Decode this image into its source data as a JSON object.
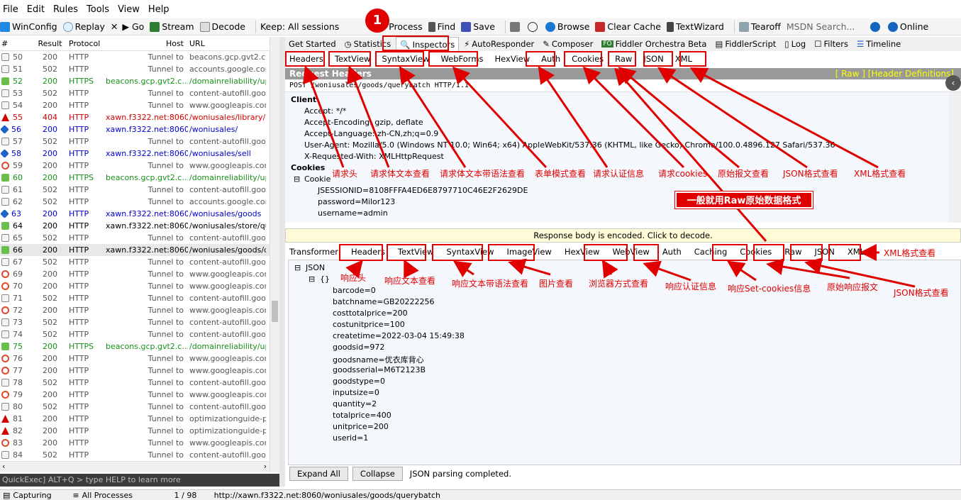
{
  "menu": [
    "File",
    "Edit",
    "Rules",
    "Tools",
    "View",
    "Help"
  ],
  "toolbar": [
    {
      "label": "WinConfig",
      "icon": "windows-icon"
    },
    {
      "label": "Replay",
      "icon": "replay-icon"
    },
    {
      "label": "▶ Go",
      "icon": "remove-icon"
    },
    {
      "label": "Stream",
      "icon": "stream-icon"
    },
    {
      "label": "Decode",
      "icon": "decode-icon"
    },
    {
      "label": "Keep: All sessions",
      "icon": ""
    },
    {
      "label": "Any Process",
      "icon": "crosshair-icon"
    },
    {
      "label": "Find",
      "icon": "find-icon"
    },
    {
      "label": "Save",
      "icon": "save-icon"
    },
    {
      "label": "Browse",
      "icon": "browser-icon"
    },
    {
      "label": "Clear Cache",
      "icon": "clear-cache-icon"
    },
    {
      "label": "TextWizard",
      "icon": "textwizard-icon"
    },
    {
      "label": "Tearoff",
      "icon": "tearoff-icon"
    },
    {
      "label": "MSDN Search...",
      "icon": ""
    },
    {
      "label": "Online",
      "icon": "online-icon"
    }
  ],
  "sessions": {
    "columns": [
      "#",
      "Result",
      "Protocol",
      "Host",
      "URL"
    ],
    "rows": [
      {
        "id": "50",
        "result": "200",
        "protocol": "HTTP",
        "host": "Tunnel to",
        "url": "beacons.gcp.gvt2.cor",
        "color": "#555",
        "icon": "lock"
      },
      {
        "id": "51",
        "result": "502",
        "protocol": "HTTP",
        "host": "Tunnel to",
        "url": "accounts.google.com:",
        "color": "#555",
        "icon": "lock"
      },
      {
        "id": "52",
        "result": "200",
        "protocol": "HTTPS",
        "host": "beacons.gcp.gvt2.c...",
        "url": "/domainreliability/uplo",
        "color": "#1a8f1a",
        "icon": "arrow"
      },
      {
        "id": "53",
        "result": "502",
        "protocol": "HTTP",
        "host": "Tunnel to",
        "url": "content-autofill.googl",
        "color": "#555",
        "icon": "lock"
      },
      {
        "id": "54",
        "result": "200",
        "protocol": "HTTP",
        "host": "Tunnel to",
        "url": "www.googleapis.com:",
        "color": "#555",
        "icon": "lock"
      },
      {
        "id": "55",
        "result": "404",
        "protocol": "HTTP",
        "host": "xawn.f3322.net:8060",
        "url": "/woniusales/library/cs",
        "color": "#d00000",
        "icon": "warn"
      },
      {
        "id": "56",
        "result": "200",
        "protocol": "HTTP",
        "host": "xawn.f3322.net:8060",
        "url": "/woniusales/",
        "color": "#0000cc",
        "icon": "diamond"
      },
      {
        "id": "57",
        "result": "502",
        "protocol": "HTTP",
        "host": "Tunnel to",
        "url": "content-autofill.googl",
        "color": "#555",
        "icon": "lock"
      },
      {
        "id": "58",
        "result": "200",
        "protocol": "HTTP",
        "host": "xawn.f3322.net:8060",
        "url": "/woniusales/sell",
        "color": "#0000cc",
        "icon": "diamond"
      },
      {
        "id": "59",
        "result": "200",
        "protocol": "HTTP",
        "host": "Tunnel to",
        "url": "www.googleapis.com:",
        "color": "#555",
        "icon": "block"
      },
      {
        "id": "60",
        "result": "200",
        "protocol": "HTTPS",
        "host": "beacons.gcp.gvt2.c...",
        "url": "/domainreliability/uplo",
        "color": "#1a8f1a",
        "icon": "arrow"
      },
      {
        "id": "61",
        "result": "502",
        "protocol": "HTTP",
        "host": "Tunnel to",
        "url": "content-autofill.googl",
        "color": "#555",
        "icon": "lock"
      },
      {
        "id": "62",
        "result": "502",
        "protocol": "HTTP",
        "host": "Tunnel to",
        "url": "accounts.google.com:",
        "color": "#555",
        "icon": "lock"
      },
      {
        "id": "63",
        "result": "200",
        "protocol": "HTTP",
        "host": "xawn.f3322.net:8060",
        "url": "/woniusales/goods",
        "color": "#0000cc",
        "icon": "diamond"
      },
      {
        "id": "64",
        "result": "200",
        "protocol": "HTTP",
        "host": "xawn.f3322.net:8060",
        "url": "/woniusales/store/que",
        "color": "#000",
        "icon": "arrow"
      },
      {
        "id": "65",
        "result": "502",
        "protocol": "HTTP",
        "host": "Tunnel to",
        "url": "content-autofill.googl",
        "color": "#555",
        "icon": "lock"
      },
      {
        "id": "66",
        "result": "200",
        "protocol": "HTTP",
        "host": "xawn.f3322.net:8060",
        "url": "/woniusales/goods/qu",
        "color": "#000",
        "icon": "arrow",
        "selected": true
      },
      {
        "id": "67",
        "result": "502",
        "protocol": "HTTP",
        "host": "Tunnel to",
        "url": "content-autofill.googl",
        "color": "#555",
        "icon": "lock"
      },
      {
        "id": "69",
        "result": "200",
        "protocol": "HTTP",
        "host": "Tunnel to",
        "url": "www.googleapis.com:",
        "color": "#555",
        "icon": "block"
      },
      {
        "id": "70",
        "result": "200",
        "protocol": "HTTP",
        "host": "Tunnel to",
        "url": "www.googleapis.com:",
        "color": "#555",
        "icon": "block"
      },
      {
        "id": "71",
        "result": "502",
        "protocol": "HTTP",
        "host": "Tunnel to",
        "url": "content-autofill.googl",
        "color": "#555",
        "icon": "lock"
      },
      {
        "id": "72",
        "result": "200",
        "protocol": "HTTP",
        "host": "Tunnel to",
        "url": "www.googleapis.com:",
        "color": "#555",
        "icon": "block"
      },
      {
        "id": "73",
        "result": "502",
        "protocol": "HTTP",
        "host": "Tunnel to",
        "url": "content-autofill.googl",
        "color": "#555",
        "icon": "lock"
      },
      {
        "id": "74",
        "result": "502",
        "protocol": "HTTP",
        "host": "Tunnel to",
        "url": "content-autofill.googl",
        "color": "#555",
        "icon": "lock"
      },
      {
        "id": "75",
        "result": "200",
        "protocol": "HTTPS",
        "host": "beacons.gcp.gvt2.c...",
        "url": "/domainreliability/uplo",
        "color": "#1a8f1a",
        "icon": "arrow"
      },
      {
        "id": "76",
        "result": "200",
        "protocol": "HTTP",
        "host": "Tunnel to",
        "url": "www.googleapis.com:",
        "color": "#555",
        "icon": "block"
      },
      {
        "id": "77",
        "result": "200",
        "protocol": "HTTP",
        "host": "Tunnel to",
        "url": "www.googleapis.com:",
        "color": "#555",
        "icon": "block"
      },
      {
        "id": "78",
        "result": "502",
        "protocol": "HTTP",
        "host": "Tunnel to",
        "url": "content-autofill.googl",
        "color": "#555",
        "icon": "lock"
      },
      {
        "id": "79",
        "result": "200",
        "protocol": "HTTP",
        "host": "Tunnel to",
        "url": "www.googleapis.com:",
        "color": "#555",
        "icon": "block"
      },
      {
        "id": "80",
        "result": "502",
        "protocol": "HTTP",
        "host": "Tunnel to",
        "url": "content-autofill.googl",
        "color": "#555",
        "icon": "lock"
      },
      {
        "id": "81",
        "result": "200",
        "protocol": "HTTP",
        "host": "Tunnel to",
        "url": "optimizationguide-pa.",
        "color": "#555",
        "icon": "warn"
      },
      {
        "id": "82",
        "result": "200",
        "protocol": "HTTP",
        "host": "Tunnel to",
        "url": "optimizationguide-pa.",
        "color": "#555",
        "icon": "warn"
      },
      {
        "id": "83",
        "result": "200",
        "protocol": "HTTP",
        "host": "Tunnel to",
        "url": "www.googleapis.com:",
        "color": "#555",
        "icon": "block"
      },
      {
        "id": "84",
        "result": "502",
        "protocol": "HTTP",
        "host": "Tunnel to",
        "url": "content-autofill.googl",
        "color": "#555",
        "icon": "lock"
      }
    ]
  },
  "quickexec": "QuickExec] ALT+Q > type HELP to learn more",
  "statusbar": {
    "capturing": "Capturing",
    "processes": "All Processes",
    "count": "1 / 98",
    "url": "http://xawn.f3322.net:8060/woniusales/goods/querybatch"
  },
  "inspector_tabs": [
    "Get Started",
    "Statistics",
    "Inspectors",
    "AutoResponder",
    "Composer",
    "Fiddler Orchestra Beta",
    "FiddlerScript",
    "Log",
    "Filters",
    "Timeline"
  ],
  "request_tabs": [
    "Headers",
    "TextView",
    "SyntaxView",
    "WebForms",
    "HexView",
    "Auth",
    "Cookies",
    "Raw",
    "JSON",
    "XML"
  ],
  "request_headers": {
    "title": "Request Headers",
    "links": "[ Raw ]   [Header Definitions]",
    "request_line": "POST /woniusales/goods/querybatch HTTP/1.1",
    "client_label": "Client",
    "client": [
      "Accept: */*",
      "Accept-Encoding: gzip, deflate",
      "Accept-Language: zh-CN,zh;q=0.9",
      "User-Agent: Mozilla/5.0 (Windows NT 10.0; Win64; x64) AppleWebKit/537.36 (KHTML, like Gecko) Chrome/100.0.4896.127 Safari/537.36",
      "X-Requested-With: XMLHttpRequest"
    ],
    "cookies_label": "Cookies",
    "cookie_label": "Cookie",
    "cookies": [
      "JSESSIONID=8108FFFA4ED6E8797710C46E2F2629DE",
      "password=Milor123",
      "username=admin"
    ]
  },
  "encoded_notice": "Response body is encoded. Click to decode.",
  "response_tabs": [
    "Transformer",
    "Headers",
    "TextView",
    "SyntaxView",
    "ImageView",
    "HexView",
    "WebView",
    "Auth",
    "Caching",
    "Cookies",
    "Raw",
    "JSON",
    "XML"
  ],
  "json_tree": {
    "root": "JSON",
    "obj": "{}",
    "items": [
      "barcode=0",
      "batchname=GB20222256",
      "costtotalprice=200",
      "costunitprice=100",
      "createtime=2022-03-04 15:49:38",
      "goodsid=972",
      "goodsname=优衣库背心",
      "goodsserial=M6T2123B",
      "goodstype=0",
      "inputsize=0",
      "quantity=2",
      "totalprice=400",
      "unitprice=200",
      "userid=1"
    ]
  },
  "buttons": {
    "expand": "Expand All",
    "collapse": "Collapse",
    "status": "JSON parsing completed."
  },
  "annotations": {
    "badge": "1",
    "callout": "一般就用Raw原始数据格式",
    "req": [
      "请求头",
      "请求体文本查看",
      "请求体文本带语法查看",
      "表单模式查看",
      "请求认证信息",
      "请求cookies",
      "原始报文查看",
      "JSON格式查看",
      "XML格式查看"
    ],
    "resp": [
      "响应头",
      "响应文本查看",
      "响应文本带语法查看",
      "图片查看",
      "浏览器方式查看",
      "响应认证信息",
      "响应Set-cookies信息",
      "原始响应报文",
      "JSON格式查看",
      "XML格式查看"
    ]
  },
  "colors": {
    "annotation": "#e00000",
    "header_bar": "#999999",
    "tree_bg": "#f4f8fd"
  }
}
